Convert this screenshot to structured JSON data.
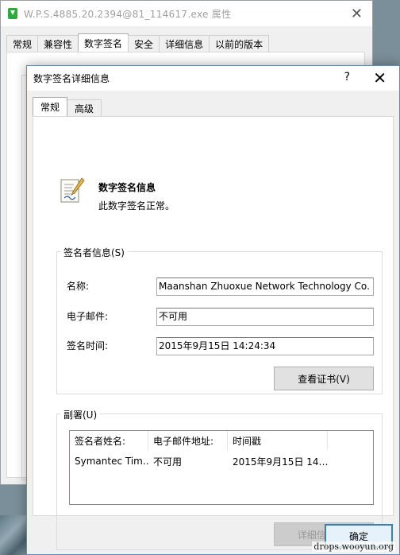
{
  "background_window": {
    "title": "W.P.S.4885.20.2394@81_114617.exe 属性",
    "close": "✕",
    "tabs": [
      "常规",
      "兼容性",
      "数字签名",
      "安全",
      "详细信息",
      "以前的版本"
    ],
    "active_tab_index": 2
  },
  "dialog": {
    "title": "数字签名详细信息",
    "help": "?",
    "close": "✕",
    "tabs": [
      "常规",
      "高级"
    ],
    "active_tab_index": 0,
    "info_title": "数字签名信息",
    "info_status": "此数字签名正常。",
    "signer_group": {
      "legend": "签名者信息(S)",
      "name_label": "名称:",
      "name_value": "Maanshan Zhuoxue Network Technology Co. L",
      "email_label": "电子邮件:",
      "email_value": "不可用",
      "time_label": "签名时间:",
      "time_value": "2015年9月15日 14:24:34",
      "view_cert_button": "查看证书(V)"
    },
    "countersign_group": {
      "legend": "副署(U)",
      "columns": [
        "签名者姓名:",
        "电子邮件地址:",
        "时间戳"
      ],
      "rows": [
        [
          "Symantec Tim…",
          "不可用",
          "2015年9月15日 14…"
        ]
      ],
      "details_button": "详细信息(D)"
    },
    "ok_button": "确定"
  },
  "watermark": "drops.wooyun.org"
}
